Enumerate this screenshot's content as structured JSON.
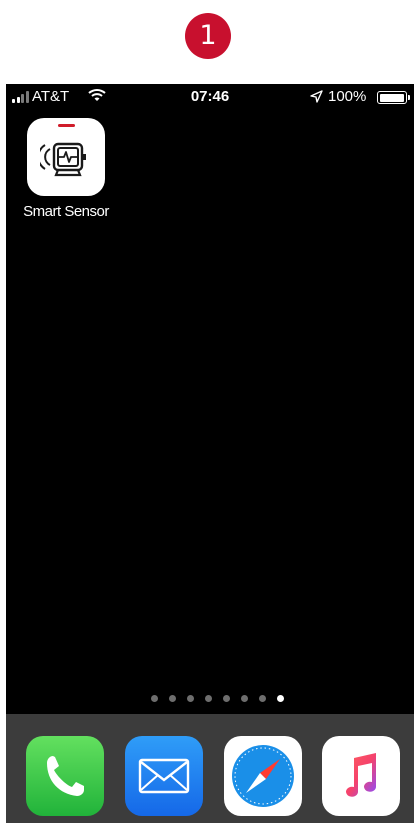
{
  "step_marker": "1",
  "status_bar": {
    "carrier": "AT&T",
    "time": "07:46",
    "battery_percent": "100%",
    "battery_level": 1.0,
    "signal_bars_filled": 2,
    "signal_bars_total": 4
  },
  "home_screen": {
    "apps": [
      {
        "label": "Smart Sensor",
        "icon": "smart-sensor-icon",
        "accent": "#d01c2a"
      }
    ],
    "page_count": 8,
    "current_page": 8
  },
  "dock": {
    "apps": [
      {
        "icon": "phone-icon",
        "color": "#2fc34a"
      },
      {
        "icon": "mail-icon",
        "color": "#1f82f2"
      },
      {
        "icon": "safari-icon",
        "color": "#1a8fe8"
      },
      {
        "icon": "music-icon",
        "color": "#f5426c"
      }
    ]
  },
  "colors": {
    "step_badge": "#c8102e",
    "screen_background": "#000000",
    "dock_background": "#3c3c3c"
  }
}
